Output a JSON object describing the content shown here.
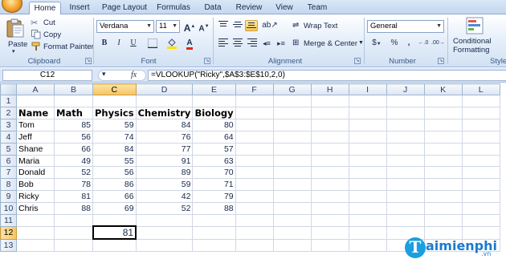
{
  "ribbon": {
    "tabs": [
      {
        "label": "Home",
        "active": true
      },
      {
        "label": "Insert"
      },
      {
        "label": "Page Layout"
      },
      {
        "label": "Formulas"
      },
      {
        "label": "Data"
      },
      {
        "label": "Review"
      },
      {
        "label": "View"
      },
      {
        "label": "Team"
      }
    ],
    "clipboard": {
      "group_label": "Clipboard",
      "paste_label": "Paste",
      "cut_label": "Cut",
      "copy_label": "Copy",
      "format_painter_label": "Format Painter"
    },
    "font": {
      "group_label": "Font",
      "font_name": "Verdana",
      "font_size": "11",
      "grow_font": "A",
      "shrink_font": "A",
      "bold": "B",
      "italic": "I",
      "underline": "U",
      "font_color": "A"
    },
    "alignment": {
      "group_label": "Alignment",
      "wrap_text_label": "Wrap Text",
      "merge_center_label": "Merge & Center"
    },
    "number": {
      "group_label": "Number",
      "format": "General",
      "currency": "$",
      "percent": "%",
      "comma": ","
    },
    "styles": {
      "group_label": "Style",
      "conditional_line1": "Conditional",
      "conditional_line2": "Formatting"
    }
  },
  "formula_bar": {
    "name_box": "C12",
    "fx_label": "fx",
    "formula": "=VLOOKUP(\"Ricky\",$A$3:$E$10,2,0)"
  },
  "sheet": {
    "columns": [
      "A",
      "B",
      "C",
      "D",
      "E",
      "F",
      "G",
      "H",
      "I",
      "J",
      "K",
      "L"
    ],
    "selected_column": "C",
    "selected_row": "12",
    "headers": [
      "Name",
      "Math",
      "Physics",
      "Chemistry",
      "Biology"
    ],
    "rows": [
      [
        "Tom",
        "85",
        "59",
        "84",
        "80"
      ],
      [
        "Jeff",
        "56",
        "74",
        "76",
        "64"
      ],
      [
        "Shane",
        "66",
        "84",
        "77",
        "57"
      ],
      [
        "Maria",
        "49",
        "55",
        "91",
        "63"
      ],
      [
        "Donald",
        "52",
        "56",
        "89",
        "70"
      ],
      [
        "Bob",
        "78",
        "86",
        "59",
        "71"
      ],
      [
        "Ricky",
        "81",
        "66",
        "42",
        "79"
      ],
      [
        "Chris",
        "88",
        "69",
        "52",
        "88"
      ]
    ],
    "result_value": "81"
  },
  "watermark": {
    "letter": "T",
    "text": "aimienphi",
    "suffix": ".vn"
  }
}
